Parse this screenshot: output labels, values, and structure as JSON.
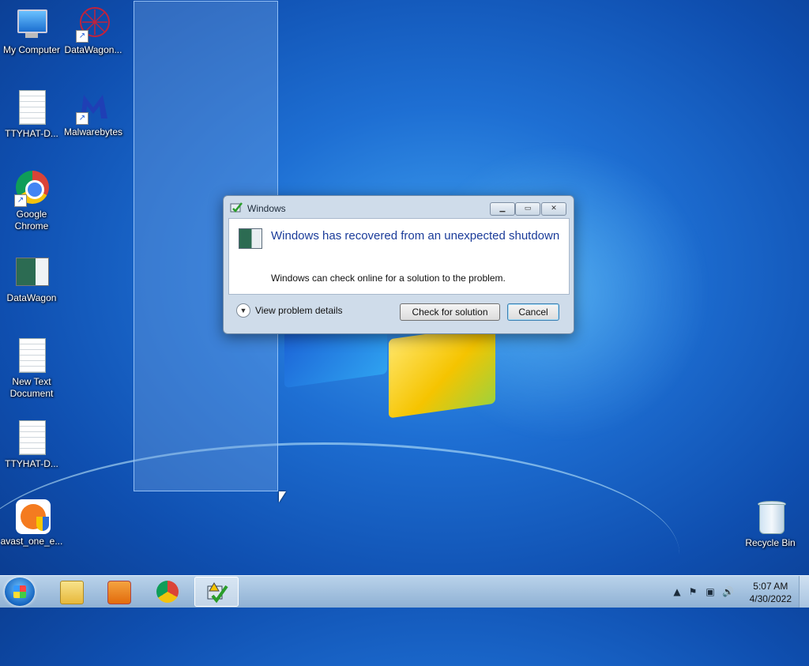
{
  "desktop": {
    "icons": [
      {
        "label": "My Computer",
        "icon": "computer-icon"
      },
      {
        "label": "DataWagon...",
        "icon": "datawagon-shortcut-icon"
      },
      {
        "label": "TTYHAT-D...",
        "icon": "text-document-icon"
      },
      {
        "label": "Malwarebytes",
        "icon": "malwarebytes-icon"
      },
      {
        "label": "Google Chrome",
        "icon": "chrome-icon"
      },
      {
        "label": "DataWagon",
        "icon": "datawagon-icon"
      },
      {
        "label": "New Text Document",
        "icon": "text-document-icon"
      },
      {
        "label": "TTYHAT-D...",
        "icon": "text-document-icon"
      },
      {
        "label": "avast_one_e...",
        "icon": "avast-installer-icon"
      },
      {
        "label": "Recycle Bin",
        "icon": "recycle-bin-icon"
      }
    ]
  },
  "dialog": {
    "title": "Windows",
    "headline": "Windows has recovered from an unexpected shutdown",
    "message": "Windows can check online for a solution to the problem.",
    "details_label": "View problem details",
    "check_button": "Check for solution",
    "cancel_button": "Cancel"
  },
  "taskbar": {
    "items": [
      "start-orb",
      "windows-explorer-icon",
      "media-player-icon",
      "chrome-icon",
      "problem-reporting-icon"
    ],
    "clock_time": "5:07 AM",
    "clock_date": "4/30/2022"
  },
  "colors": {
    "headline": "#1b3c9a",
    "desktop_blue": "#1e6fd3"
  }
}
